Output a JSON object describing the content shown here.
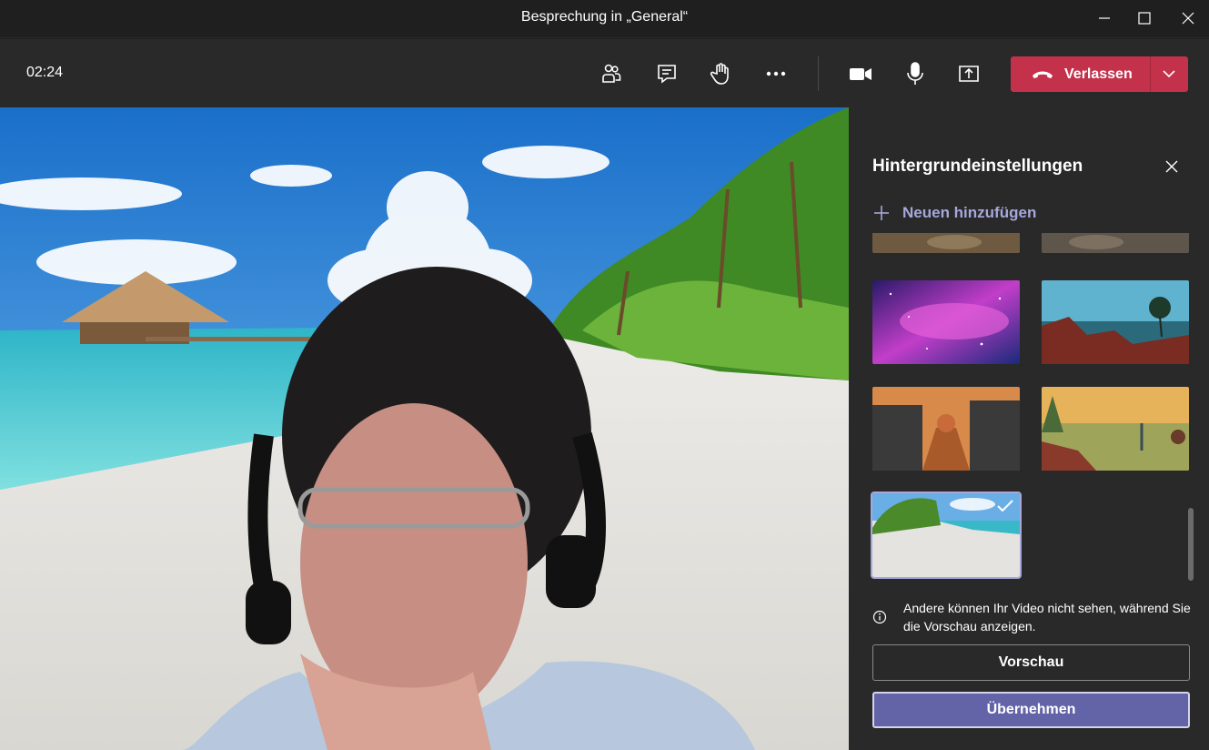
{
  "window": {
    "title": "Besprechung in „General“",
    "controls": [
      "minimize-icon",
      "maximize-icon",
      "close-icon"
    ]
  },
  "toolbar": {
    "timer": "02:24",
    "buttons": [
      "participants-icon",
      "chat-icon",
      "raise-hand-icon",
      "more-options-icon",
      "camera-icon",
      "microphone-icon",
      "share-screen-icon"
    ],
    "leave_label": "Verlassen",
    "leave_color": "#c4314b"
  },
  "panel": {
    "title": "Hintergrundeinstellungen",
    "add_new": "Neuen hinzufügen",
    "backgrounds": [
      "game-scene-1",
      "game-scene-2",
      "galaxy",
      "alien-landscape",
      "village-street",
      "painted-desert",
      "beach"
    ],
    "selected_background": "beach",
    "info_text": "Andere können Ihr Video nicht sehen, während Sie die Vorschau anzeigen.",
    "preview_label": "Vorschau",
    "apply_label": "Übernehmen",
    "accent": "#6264a7"
  }
}
